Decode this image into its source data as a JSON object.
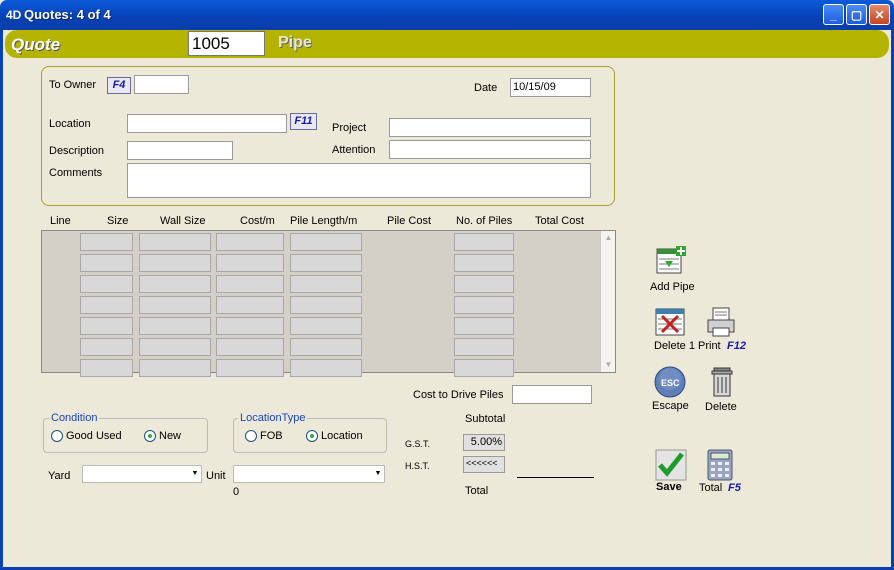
{
  "window": {
    "app_icon": "4D",
    "title": "Quotes: 4 of 4",
    "controls": {
      "minimize": "_",
      "maximize": "▢",
      "close": "✕"
    }
  },
  "header": {
    "label": "Quote",
    "quote_number": "1005",
    "subtitle": "Pipe"
  },
  "form": {
    "to_owner": {
      "label": "To Owner",
      "key": "F4",
      "value": ""
    },
    "date": {
      "label": "Date",
      "value": "10/15/09"
    },
    "location": {
      "label": "Location",
      "key": "F11",
      "value": ""
    },
    "project": {
      "label": "Project",
      "value": ""
    },
    "description": {
      "label": "Description",
      "value": ""
    },
    "attention": {
      "label": "Attention",
      "value": ""
    },
    "comments": {
      "label": "Comments",
      "value": ""
    }
  },
  "table": {
    "headers": [
      "Line",
      "Size",
      "Wall Size",
      "Cost/m",
      "Pile Length/m",
      "Pile Cost",
      "No. of Piles",
      "Total Cost"
    ],
    "row_count": 7
  },
  "cost_to_drive": {
    "label": "Cost to Drive Piles",
    "value": ""
  },
  "condition": {
    "title": "Condition",
    "options": [
      "Good Used",
      "New"
    ],
    "selected": "New"
  },
  "location_type": {
    "title": "LocationType",
    "options": [
      "FOB",
      "Location"
    ],
    "selected": "Location"
  },
  "yard": {
    "label": "Yard",
    "value": ""
  },
  "unit": {
    "label": "Unit",
    "value": "",
    "below": "0"
  },
  "totals": {
    "subtotal_label": "Subtotal",
    "gst_label": "G.S.T.",
    "gst_value": "5.00%",
    "hst_label": "H.S.T.",
    "hst_value": "<<<<<<",
    "total_label": "Total"
  },
  "buttons": {
    "add_pipe": "Add Pipe",
    "delete_1": "Delete 1",
    "print": "Print",
    "print_key": "F12",
    "escape": "Escape",
    "escape_icon_text": "ESC",
    "delete": "Delete",
    "save": "Save",
    "total": "Total",
    "total_key": "F5"
  },
  "colors": {
    "header_bar": "#B4B400",
    "titlebar": "#0841B5",
    "background": "#ECE9D8",
    "fkey_text": "#1A1AA8"
  }
}
